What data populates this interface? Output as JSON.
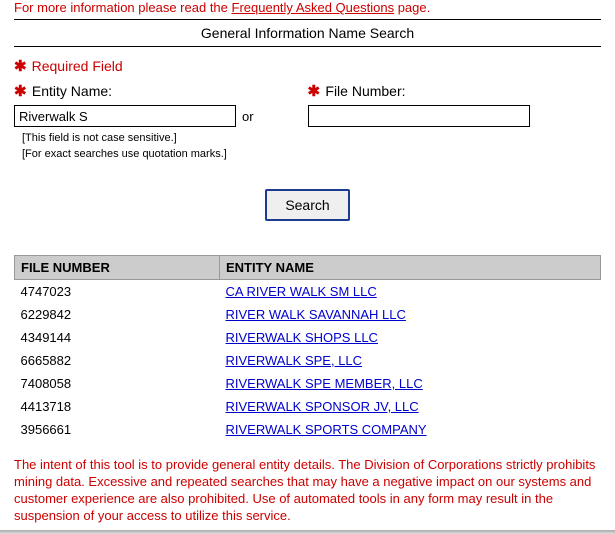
{
  "top_notice": {
    "prefix": "For more information please read the ",
    "link": "Frequently Asked Questions",
    "suffix": " page."
  },
  "title": "General Information Name Search",
  "form": {
    "required_label": "Required Field",
    "entity_name_label": "Entity Name:",
    "file_number_label": "File Number:",
    "entity_name_value": "Riverwalk S",
    "file_number_value": "",
    "or_text": "or",
    "hint1": "[This field is not case sensitive.]",
    "hint2": "[For exact searches use quotation marks.]",
    "search_button": "Search"
  },
  "table": {
    "headers": {
      "file_number": "FILE NUMBER",
      "entity_name": "ENTITY NAME"
    },
    "rows": [
      {
        "file_number": "4747023",
        "entity_name": "CA RIVER WALK SM LLC"
      },
      {
        "file_number": "6229842",
        "entity_name": "RIVER WALK SAVANNAH LLC"
      },
      {
        "file_number": "4349144",
        "entity_name": "RIVERWALK SHOPS LLC"
      },
      {
        "file_number": "6665882",
        "entity_name": "RIVERWALK SPE, LLC"
      },
      {
        "file_number": "7408058",
        "entity_name": "RIVERWALK SPE MEMBER, LLC"
      },
      {
        "file_number": "4413718",
        "entity_name": "RIVERWALK SPONSOR JV, LLC"
      },
      {
        "file_number": "3956661",
        "entity_name": "RIVERWALK SPORTS COMPANY"
      }
    ]
  },
  "disclaimer": "The intent of this tool is to provide general entity details. The Division of Corporations strictly prohibits mining data. Excessive and repeated searches that may have a negative impact on our systems and customer experience are also prohibited. Use of automated tools in any form may result in the suspension of your access to utilize this service."
}
